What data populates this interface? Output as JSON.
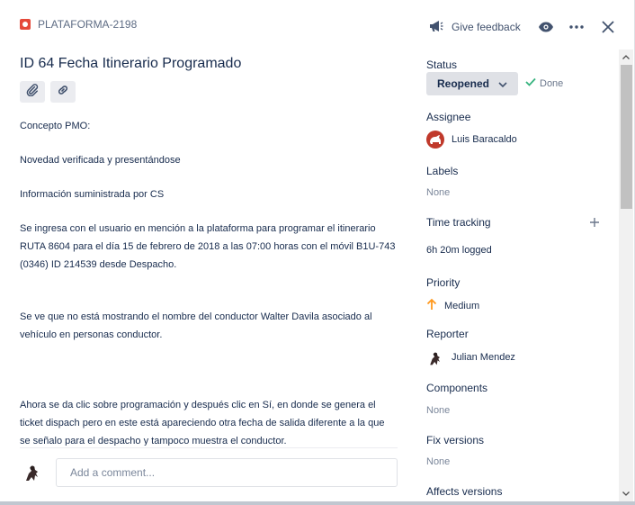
{
  "header": {
    "issue_key": "PLATAFORMA-2198",
    "feedback_label": "Give feedback"
  },
  "issue": {
    "title": "ID 64 Fecha Itinerario Programado",
    "description": [
      "Concepto PMO:",
      "Novedad verificada y presentándose",
      "Información suministrada por CS",
      "Se ingresa con el usuario en mención a la plataforma para programar el itinerario RUTA 8604 para el día 15 de febrero de 2018 a las 07:00 horas con el móvil B1U-743 (0346) ID 214539 desde Despacho.",
      "Se ve que no está mostrando el nombre del conductor Walter Davila asociado al vehículo en personas conductor.",
      "Ahora se da clic sobre programación y después clic en Sí, en donde se genera el ticket dispach pero en este está apareciendo otra fecha de salida diferente a la que se señalo para el despacho y tampoco muestra el conductor."
    ]
  },
  "comment": {
    "placeholder": "Add a comment..."
  },
  "sidebar": {
    "status_label": "Status",
    "status_value": "Reopened",
    "done_label": "Done",
    "assignee_label": "Assignee",
    "assignee_name": "Luis Baracaldo",
    "labels_label": "Labels",
    "labels_value": "None",
    "time_tracking_label": "Time tracking",
    "time_logged": "6h 20m logged",
    "priority_label": "Priority",
    "priority_value": "Medium",
    "reporter_label": "Reporter",
    "reporter_name": "Julian Mendez",
    "components_label": "Components",
    "components_value": "None",
    "fix_versions_label": "Fix versions",
    "fix_versions_value": "None",
    "affects_versions_label": "Affects versions"
  },
  "colors": {
    "bug": "#e5493a",
    "priority_medium": "#ff991f",
    "done_check": "#36b37e",
    "assignee_avatar": "#c0392b"
  }
}
